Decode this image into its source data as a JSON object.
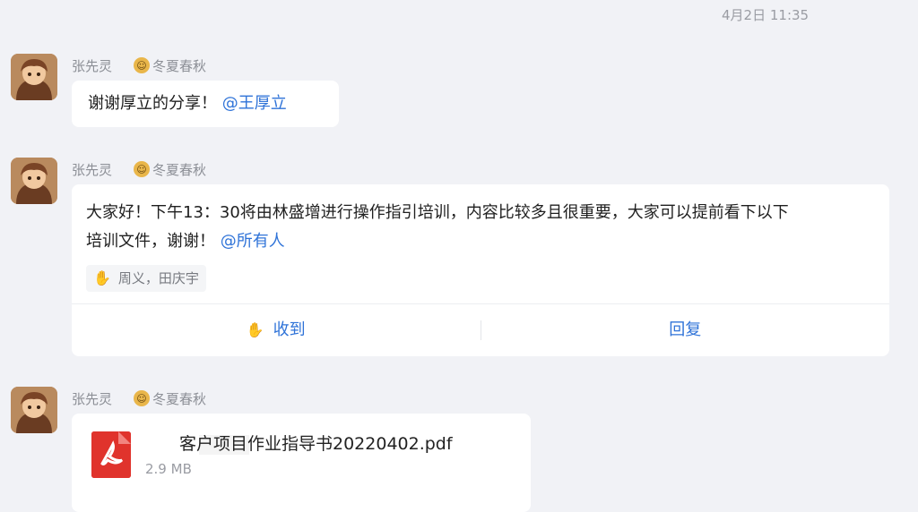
{
  "timestamp": "4月2日 11:35",
  "messages": [
    {
      "sender": "张先灵",
      "group": "冬夏春秋",
      "text": "谢谢厚立的分享！",
      "mention": "@王厚立"
    },
    {
      "sender": "张先灵",
      "group": "冬夏春秋",
      "line1": "大家好！下午13：30将由林盛增进行操作指引培训，内容比较多且很重要，大家可以提前看下以下",
      "line2": "培训文件，谢谢！",
      "mention": "@所有人",
      "read_by": "周义，田庆宇",
      "action_received": "收到",
      "action_reply": "回复"
    },
    {
      "sender": "张先灵",
      "group": "冬夏春秋",
      "file_name": "客户项目作业指导书20220402.pdf",
      "file_size": "2.9 MB",
      "file_icon": "pdf-icon"
    }
  ],
  "colors": {
    "background": "#f1f2f6",
    "mention": "#2f73d8",
    "pdf": "#e0332c"
  }
}
